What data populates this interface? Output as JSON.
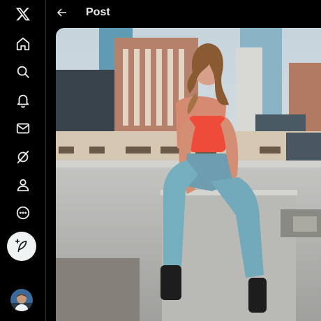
{
  "header": {
    "title": "Post",
    "back_icon": "arrow-left-icon"
  },
  "sidebar": {
    "logo_icon": "x-logo-icon",
    "items": [
      {
        "name": "home",
        "icon": "home-icon"
      },
      {
        "name": "explore",
        "icon": "search-icon"
      },
      {
        "name": "notifications",
        "icon": "bell-icon"
      },
      {
        "name": "messages",
        "icon": "envelope-icon"
      },
      {
        "name": "grok",
        "icon": "grok-icon"
      },
      {
        "name": "profile",
        "icon": "person-icon"
      },
      {
        "name": "more",
        "icon": "more-circle-icon"
      }
    ],
    "compose_icon": "feather-plus-icon"
  },
  "colors": {
    "background": "#000000",
    "text": "#e7e9ea",
    "compose_bg": "#eff3f4",
    "divider": "#2f3336"
  }
}
